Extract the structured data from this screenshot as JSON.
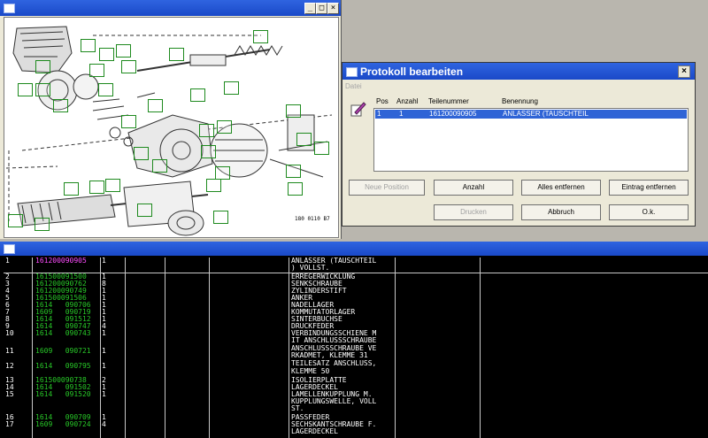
{
  "diagram_window": {
    "icon": "window-icon",
    "controls": [
      "_",
      "□",
      "×"
    ],
    "drawing_number": "180 0110 B7",
    "callouts": [
      "15",
      "18",
      "19",
      "20",
      "21",
      "40",
      "4",
      "14",
      "7",
      "8",
      "1",
      "17",
      "16",
      "5",
      "26",
      "24"
    ]
  },
  "protocol_dialog": {
    "title": "Protokoll bearbeiten",
    "close": "×",
    "menu": "Datei",
    "icon": "edit-pen-icon",
    "columns": {
      "pos": "Pos",
      "anzahl": "Anzahl",
      "teilenummer": "Teilenummer",
      "benennung": "Benennung"
    },
    "row": {
      "pos": "1",
      "anzahl": "1",
      "teilenummer": "161200090905",
      "benennung": "ANLASSER (TAUSCHTEIL"
    },
    "buttons": {
      "neue_position": "Neue Position",
      "anzahl": "Anzahl",
      "alles_entfernen": "Alles entfernen",
      "eintrag_entfernen": "Eintrag entfernen",
      "drucken": "Drucken",
      "abbruch": "Abbruch",
      "ok": "O.k."
    }
  },
  "parts_table": {
    "rows": [
      {
        "pos": "1",
        "part": "161200090905",
        "qty": "1",
        "name": "ANLASSER (TAUSCHTEIL",
        "name2": ") VOLLST.",
        "selected": true
      },
      {
        "pos": "2",
        "part": "161500091500",
        "qty": "1",
        "name": "ERREGERWICKLUNG"
      },
      {
        "pos": "3",
        "part": "161200090762",
        "qty": "8",
        "name": "SENKSCHRAUBE"
      },
      {
        "pos": "4",
        "part": "161200090749",
        "qty": "1",
        "name": "ZYLINDERSTIFT"
      },
      {
        "pos": "5",
        "part": "161500091506",
        "qty": "1",
        "name": "ANKER"
      },
      {
        "pos": "6",
        "part": "1614   090706",
        "qty": "1",
        "name": "NADELLAGER"
      },
      {
        "pos": "7",
        "part": "1609   090719",
        "qty": "1",
        "name": "KOMMUTATORLAGER"
      },
      {
        "pos": "8",
        "part": "1614   091512",
        "qty": "1",
        "name": "SINTERBUCHSE"
      },
      {
        "pos": "9",
        "part": "1614   090747",
        "qty": "4",
        "name": "DRUCKFEDER"
      },
      {
        "pos": "10",
        "part": "1614   090743",
        "qty": "1",
        "name": "VERBINDUNGSSCHIENE M",
        "name2": "IT ANSCHLUSSSCHRAUBE"
      },
      {
        "pos": "11",
        "part": "1609   090721",
        "qty": "1",
        "name": "ANSCHLUSSSCHRAUBE VE",
        "name2": "RKADMET, KLEMME 31"
      },
      {
        "pos": "12",
        "part": "1614   090795",
        "qty": "1",
        "name": "TEILESATZ ANSCHLUSS,",
        "name2": "KLEMME 50"
      },
      {
        "pos": "13",
        "part": "161500090738",
        "qty": "2",
        "name": "ISOLIERPLATTE"
      },
      {
        "pos": "14",
        "part": "1614   091502",
        "qty": "1",
        "name": "LAGERDECKEL"
      },
      {
        "pos": "15",
        "part": "1614   091520",
        "qty": "1",
        "name": "LAMELLENKUPPLUNG M.",
        "name2": "KUPPLUNGSWELLE, VOLL",
        "name3": "ST."
      },
      {
        "pos": "16",
        "part": "1614   090709",
        "qty": "1",
        "name": "PASSFEDER"
      },
      {
        "pos": "17",
        "part": "1609   090724",
        "qty": "4",
        "name": "SECHSKANTSCHRAUBE F.",
        "name2": "LAGERDECKEL"
      }
    ]
  }
}
